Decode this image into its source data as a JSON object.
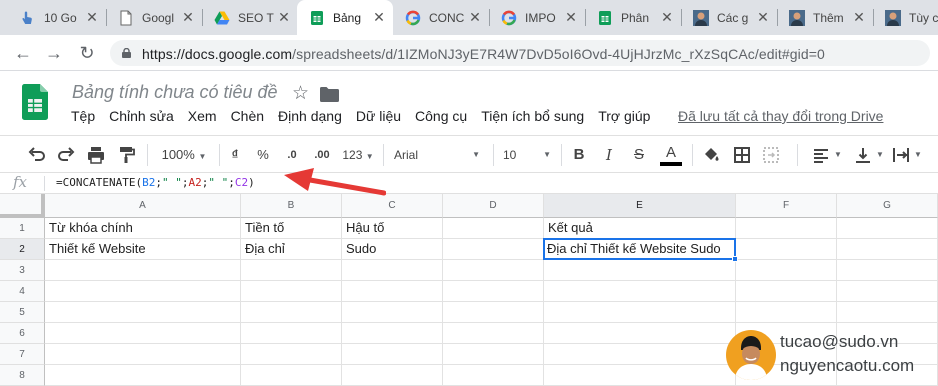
{
  "browser": {
    "tabs": [
      {
        "title": "10 Go",
        "icon": "hand-pointer-icon"
      },
      {
        "title": "Googl",
        "icon": "document-page-icon"
      },
      {
        "title": "SEO T",
        "icon": "google-drive-icon"
      },
      {
        "title": "Bảng",
        "icon": "google-sheets-icon",
        "active": true
      },
      {
        "title": "CONC",
        "icon": "google-g-icon"
      },
      {
        "title": "IMPO",
        "icon": "google-g-icon"
      },
      {
        "title": "Phân",
        "icon": "google-sheets-icon"
      },
      {
        "title": "Các g",
        "icon": "avatar-icon"
      },
      {
        "title": "Thêm",
        "icon": "avatar-icon"
      },
      {
        "title": "Tùy c",
        "icon": "avatar-icon"
      }
    ],
    "url_main": "https://docs.google.com",
    "url_rest": "/spreadsheets/d/1IZMoNJ3yE7R4W7DvD5oI6Ovd-4UjHJrzMc_rXzSqCAc/edit#gid=0"
  },
  "doc": {
    "title": "Bảng tính chưa có tiêu đề",
    "menu": [
      "Tệp",
      "Chỉnh sửa",
      "Xem",
      "Chèn",
      "Định dạng",
      "Dữ liệu",
      "Công cụ",
      "Tiện ích bổ sung",
      "Trợ giúp"
    ],
    "save_status": "Đã lưu tất cả thay đổi trong Drive"
  },
  "toolbar": {
    "zoom": "100%",
    "currency": "₫",
    "percent": "%",
    "decimal_decrease": ".0",
    "decimal_increase": ".00",
    "number_format": "123",
    "font": "Arial",
    "font_size": "10",
    "bold": "B",
    "italic": "I",
    "strikethrough": "S",
    "text_color": "A"
  },
  "formula_bar": {
    "fx": "fx",
    "p1": "=CONCATENATE(",
    "r1": "B2",
    "p2": ";",
    "s1": "\" \"",
    "p3": ";",
    "r2": "A2",
    "p4": ";",
    "s2": "\" \"",
    "p5": ";",
    "r3": "C2",
    "p6": ")"
  },
  "sheet": {
    "columns": [
      "A",
      "B",
      "C",
      "D",
      "E",
      "F",
      "G"
    ],
    "rows": [
      "1",
      "2",
      "3",
      "4",
      "5",
      "6",
      "7",
      "8"
    ],
    "cells": {
      "A1": "Từ khóa chính",
      "B1": "Tiền tố",
      "C1": "Hậu tố",
      "E1": "Kết quả",
      "A2": "Thiết kế Website",
      "B2": "Địa chỉ",
      "C2": "Sudo",
      "E2": "Địa chỉ Thiết kế Website Sudo"
    },
    "active_cell": "E2"
  },
  "watermark": {
    "line1": "tucao@sudo.vn",
    "line2": "nguyencaotu.com"
  },
  "colors": {
    "accent": "#1a73e8",
    "sheets_green": "#0f9d58",
    "arrow_red": "#e53935"
  }
}
